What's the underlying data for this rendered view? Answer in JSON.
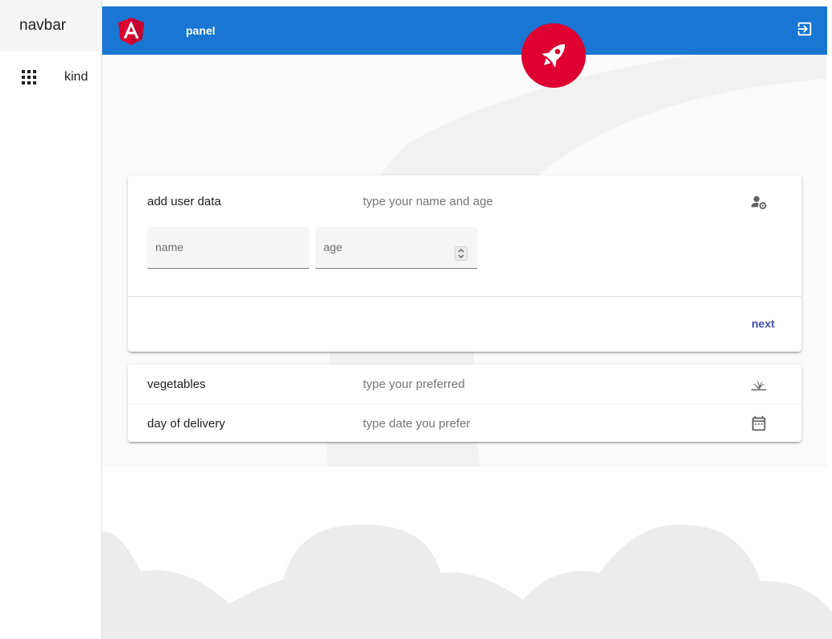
{
  "sidebar": {
    "title": "navbar",
    "items": [
      {
        "label": "kind",
        "icon": "apps-icon"
      }
    ]
  },
  "toolbar": {
    "title": "panel",
    "logo_icon": "angular-logo-icon",
    "logout_icon": "logout-icon",
    "color": "#1976d2"
  },
  "badge": {
    "icon": "rocket-icon",
    "color": "#dd0031"
  },
  "panels": [
    {
      "title": "add user data",
      "description": "type your name and age",
      "icon": "manage-accounts-icon",
      "expanded": true,
      "fields": [
        {
          "label": "name",
          "value": ""
        },
        {
          "label": "age",
          "value": ""
        }
      ],
      "action_label": "next"
    },
    {
      "title": "vegetables",
      "description": "type your preferred",
      "icon": "grass-icon",
      "expanded": false
    },
    {
      "title": "day of delivery",
      "description": "type date you prefer",
      "icon": "calendar-icon",
      "expanded": false
    }
  ]
}
